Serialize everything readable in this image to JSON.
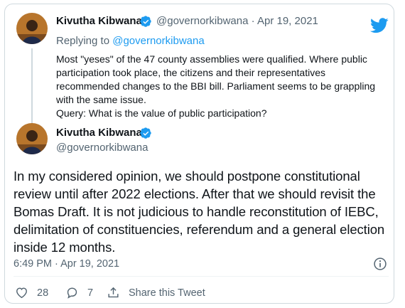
{
  "reply_tweet": {
    "author_name": "Kivutha Kibwana",
    "handle": "@governorkibwana",
    "separator": "·",
    "date": "Apr 19, 2021",
    "replying_prefix": "Replying to ",
    "replying_handle": "@governorkibwana",
    "text_lines": [
      "Most  \"yeses\" of the 47 county assemblies were qualified. Where public participation took place, the citizens and their representatives recommended changes to the BBI bill. Parliament seems to be grappling with the same issue.",
      "Query: What is the value of public participation?"
    ]
  },
  "main_tweet": {
    "author_name": "Kivutha Kibwana",
    "handle": "@governorkibwana",
    "text": "In my considered opinion, we should postpone  constitutional review until after 2022 elections. After that we should revisit the Bomas Draft. It is not judicious to handle reconstitution of IEBC, delimitation of constituencies, referendum and a general election inside 12 months.",
    "timestamp": "6:49 PM · Apr 19, 2021"
  },
  "actions": {
    "likes": "28",
    "replies": "7",
    "share_label": "Share this Tweet"
  },
  "icons": {
    "brand": "twitter-bird-icon",
    "verified": "verified-badge-icon",
    "info": "info-icon",
    "like": "heart-icon",
    "reply": "reply-bubble-icon",
    "share": "share-icon"
  },
  "colors": {
    "accent": "#1d9bf0",
    "text": "#0f1419",
    "muted": "#536471",
    "border": "#cfd9de"
  }
}
